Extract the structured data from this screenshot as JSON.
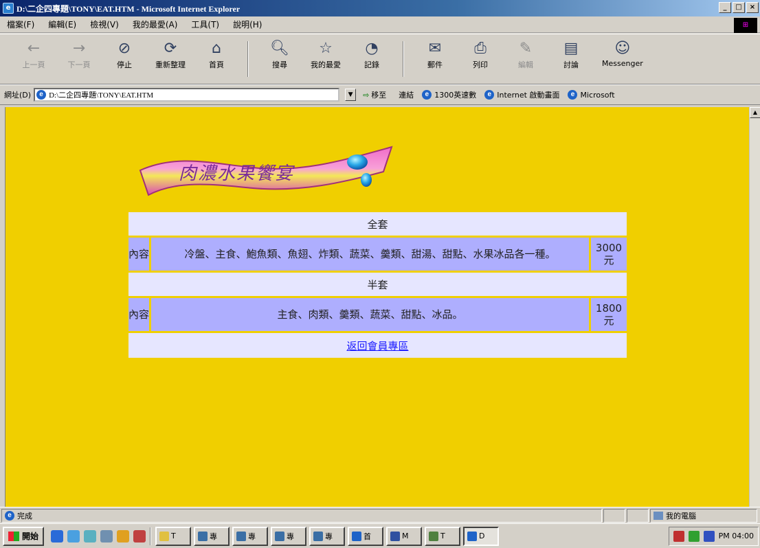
{
  "window": {
    "title": "D:\\二企四專題\\TONY\\EAT.HTM - Microsoft Internet Explorer",
    "minimize": "_",
    "maximize": "□",
    "close": "×"
  },
  "menubar": {
    "items": [
      "檔案(F)",
      "編輯(E)",
      "檢視(V)",
      "我的最愛(A)",
      "工具(T)",
      "說明(H)"
    ]
  },
  "toolbar": {
    "back": "上一頁",
    "forward": "下一頁",
    "stop": "停止",
    "refresh": "重新整理",
    "home": "首頁",
    "search": "搜尋",
    "favorites": "我的最愛",
    "history": "記錄",
    "mail": "郵件",
    "print": "列印",
    "edit": "編輯",
    "discuss": "討論",
    "messenger": "Messenger"
  },
  "addressbar": {
    "label": "網址(D)",
    "url": "D:\\二企四專題\\TONY\\EAT.HTM",
    "go": "移至",
    "links_label": "連結",
    "links": [
      "1300英速數",
      "Internet 啟動畫面",
      "Microsoft"
    ]
  },
  "page": {
    "banner_text": "肉濃水果饗宴",
    "set1": {
      "title": "全套",
      "label": "內容",
      "description": "冷盤、主食、鮑魚類、魚翅、炸類、蔬菜、羹類、甜湯、甜點、水果冰品各一種。",
      "price": "3000元"
    },
    "set2": {
      "title": "半套",
      "label": "內容",
      "description": "主食、肉類、羹類、蔬菜、甜點、冰品。",
      "price": "1800元"
    },
    "back_link": "返回會員專區"
  },
  "statusbar": {
    "status": "完成",
    "zone": "我的電腦"
  },
  "taskbar": {
    "start": "開始",
    "tasks": [
      "T",
      "專",
      "專",
      "專",
      "專",
      "首",
      "M",
      "T",
      "D"
    ],
    "clock": "PM 04:00"
  },
  "colors": {
    "page_bg": "#f0cf00",
    "header_cell": "#e6e6ff",
    "body_cell": "#aeaefe",
    "link": "#1a1aff",
    "title_bar": "#0a246a"
  }
}
